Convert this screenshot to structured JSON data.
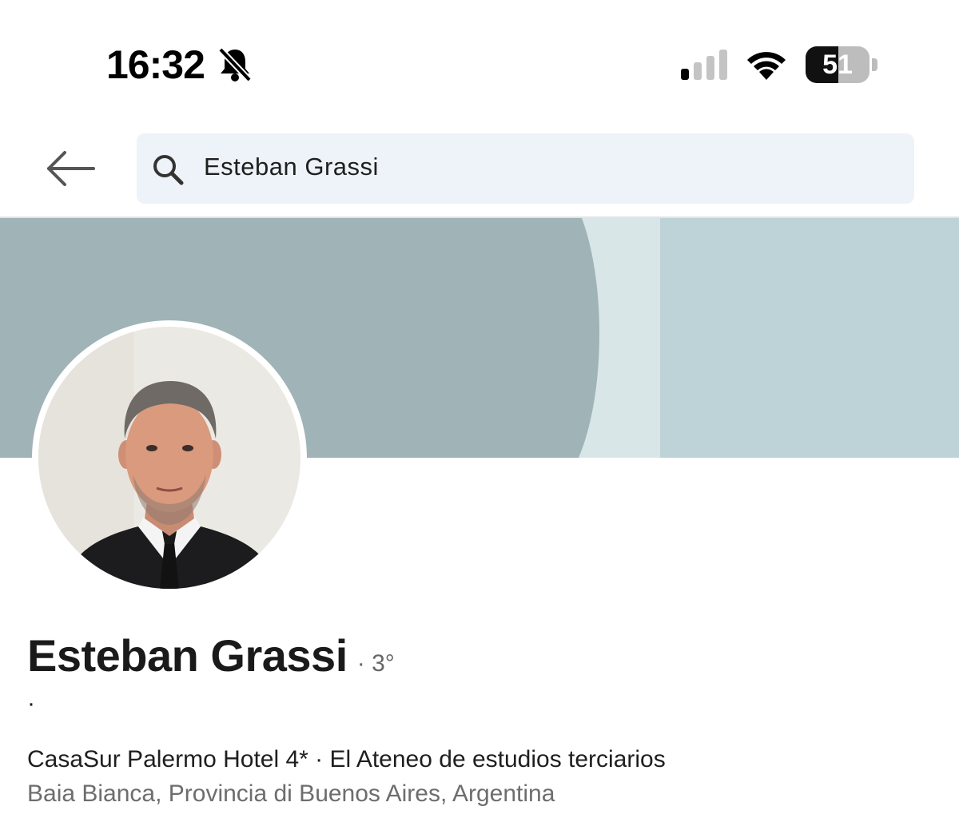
{
  "status_bar": {
    "time": "16:32",
    "battery_level": "51",
    "battery_fraction": 0.51,
    "icons": [
      "bell-slash-icon",
      "cellular-signal-icon",
      "wifi-icon",
      "battery-icon"
    ]
  },
  "top_bar": {
    "back_icon": "arrow-left-icon",
    "search_icon": "search-icon",
    "search_value": "Esteban Grassi"
  },
  "cover": {
    "colors": [
      "#a0b3b7",
      "#d9e6e8",
      "#bed3d7"
    ]
  },
  "profile": {
    "name": "Esteban Grassi",
    "degree": "· 3°",
    "headline": "·",
    "experience": "CasaSur Palermo Hotel 4* · El Ateneo de estudios terciarios",
    "location": "Baia Bianca, Provincia di Buenos Aires, Argentina"
  }
}
